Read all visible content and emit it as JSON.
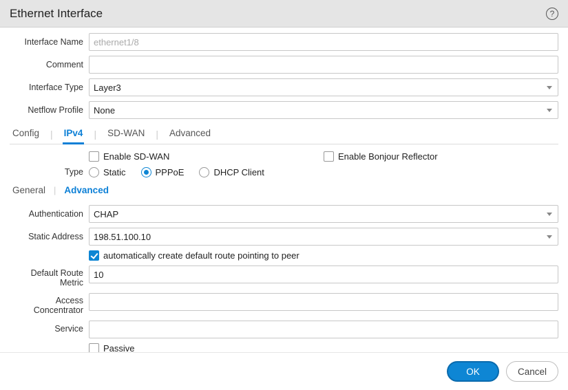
{
  "title": "Ethernet Interface",
  "labels": {
    "interface_name": "Interface Name",
    "comment": "Comment",
    "interface_type": "Interface Type",
    "netflow_profile": "Netflow Profile",
    "type": "Type",
    "authentication": "Authentication",
    "static_address": "Static Address",
    "default_route_metric": "Default Route Metric",
    "access_concentrator": "Access Concentrator",
    "service": "Service"
  },
  "values": {
    "interface_name_placeholder": "ethernet1/8",
    "comment": "",
    "interface_type": "Layer3",
    "netflow_profile": "None",
    "authentication": "CHAP",
    "static_address": "198.51.100.10",
    "default_route_metric": "10",
    "access_concentrator": "",
    "service": ""
  },
  "tabs": {
    "config": "Config",
    "ipv4": "IPv4",
    "sdwan": "SD-WAN",
    "advanced": "Advanced",
    "active": "ipv4"
  },
  "checkboxes": {
    "enable_sdwan": {
      "label": "Enable SD-WAN",
      "checked": false
    },
    "enable_bonjour": {
      "label": "Enable Bonjour Reflector",
      "checked": false
    },
    "auto_default_route": {
      "label": "automatically create default route pointing to peer",
      "checked": true
    },
    "passive": {
      "label": "Passive",
      "checked": false
    }
  },
  "type_radios": {
    "static": "Static",
    "pppoe": "PPPoE",
    "dhcp": "DHCP Client",
    "selected": "pppoe"
  },
  "subtabs": {
    "general": "General",
    "advanced": "Advanced",
    "active": "advanced"
  },
  "buttons": {
    "ok": "OK",
    "cancel": "Cancel"
  }
}
